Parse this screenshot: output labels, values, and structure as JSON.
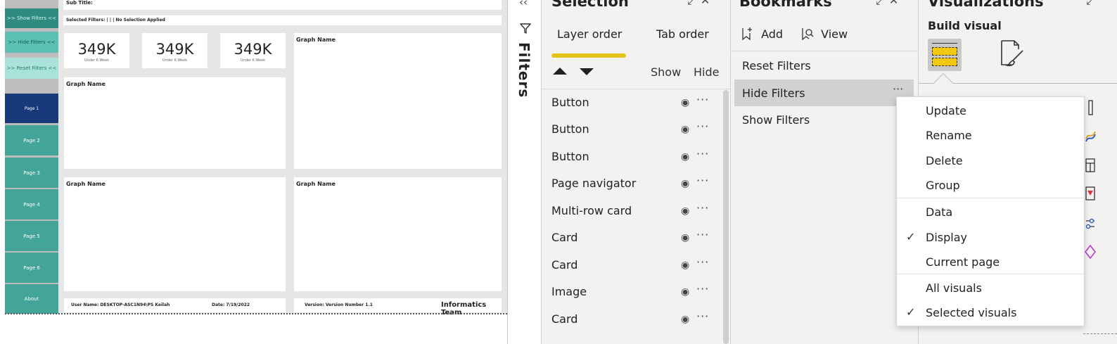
{
  "report": {
    "subtitle": "Sub Title:",
    "selected_filters": "Selected Filters: | | | No Selection Applied",
    "nav": {
      "show_filters": ">> Show Filters <<",
      "hide_filters": ">> Hide Filters <<",
      "reset_filters": ">> Reset Filters <<",
      "page1": "Page 1",
      "page2": "Page 2",
      "page3": "Page 3",
      "page4": "Page 4",
      "page5": "Page 5",
      "page6": "Page 6",
      "about": "About"
    },
    "kpis": [
      {
        "value": "349K",
        "label": "Under 6 Week"
      },
      {
        "value": "349K",
        "label": "Under 6 Week"
      },
      {
        "value": "349K",
        "label": "Under 6 Week"
      }
    ],
    "graph_name": "Graph Name",
    "footer": {
      "user": "User Name: DESKTOP-ASC1N94\\PS Keilah",
      "date": "Date: 7/19/2022",
      "version": "Version: Version Number 1.1",
      "team": "Informatics Team"
    }
  },
  "filters_pane": {
    "label": "Filters"
  },
  "selection_pane": {
    "title": "Selection",
    "tabs": [
      "Layer order",
      "Tab order"
    ],
    "show_label": "Show",
    "hide_label": "Hide",
    "items": [
      "Button",
      "Button",
      "Button",
      "Page navigator",
      "Multi-row card",
      "Card",
      "Card",
      "Image",
      "Card"
    ]
  },
  "bookmarks_pane": {
    "title": "Bookmarks",
    "add_label": "Add",
    "view_label": "View",
    "items": [
      "Reset Filters",
      "Hide Filters",
      "Show Filters"
    ],
    "selected_index": 1
  },
  "visualizations_pane": {
    "title": "Visualizations",
    "build_visual_label": "Build visual"
  },
  "context_menu": {
    "items": [
      {
        "label": "Update",
        "checked": false
      },
      {
        "label": "Rename",
        "checked": false
      },
      {
        "label": "Delete",
        "checked": false
      },
      {
        "label": "Group",
        "checked": false
      },
      {
        "label": "Data",
        "checked": false
      },
      {
        "label": "Display",
        "checked": true
      },
      {
        "label": "Current page",
        "checked": false
      },
      {
        "label": "All visuals",
        "checked": false
      },
      {
        "label": "Selected visuals",
        "checked": true
      }
    ]
  },
  "colors": {
    "accent_yellow": "#e5c41a",
    "teal_nav": "#43a597",
    "navy_active": "#183a7a",
    "pane_bg": "#f3f2f1"
  }
}
